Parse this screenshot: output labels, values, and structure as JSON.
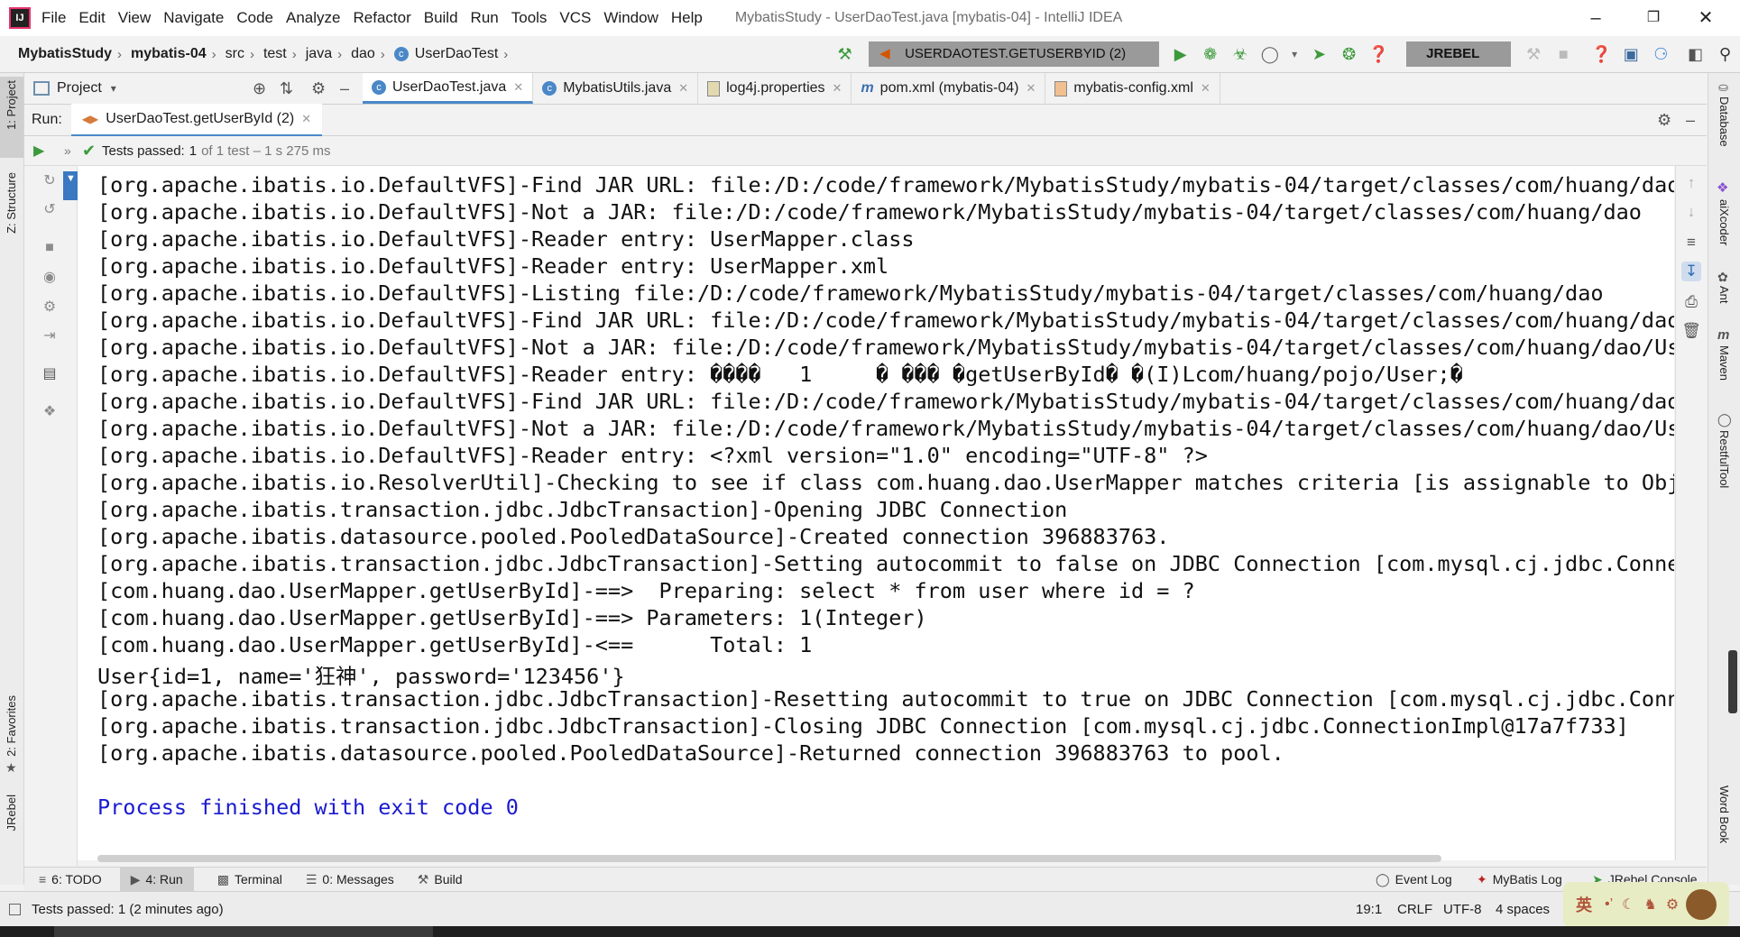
{
  "window": {
    "title": "MybatisStudy - UserDaoTest.java [mybatis-04] - IntelliJ IDEA",
    "menu": [
      "File",
      "Edit",
      "View",
      "Navigate",
      "Code",
      "Analyze",
      "Refactor",
      "Build",
      "Run",
      "Tools",
      "VCS",
      "Window",
      "Help"
    ]
  },
  "breadcrumb": [
    "MybatisStudy",
    "mybatis-04",
    "src",
    "test",
    "java",
    "dao",
    "UserDaoTest"
  ],
  "toolbar": {
    "run_config": "USERDAOTEST.GETUSERBYID (2)",
    "jrebel": "JREBEL"
  },
  "project_panel": {
    "label": "Project"
  },
  "editor_tabs": [
    {
      "label": "UserDaoTest.java",
      "icon": "class-icon"
    },
    {
      "label": "MybatisUtils.java",
      "icon": "class-icon"
    },
    {
      "label": "log4j.properties",
      "icon": "properties-icon"
    },
    {
      "label": "pom.xml (mybatis-04)",
      "icon": "maven-icon"
    },
    {
      "label": "mybatis-config.xml",
      "icon": "xml-icon"
    }
  ],
  "run_panel": {
    "label": "Run:",
    "tab": "UserDaoTest.getUserById (2)",
    "status_passed": "Tests passed:",
    "status_count": "1",
    "status_detail": "of 1 test – 1 s 275 ms"
  },
  "console": {
    "lines": [
      "[org.apache.ibatis.io.DefaultVFS]-Find JAR URL: file:/D:/code/framework/MybatisStudy/mybatis-04/target/classes/com/huang/dao",
      "[org.apache.ibatis.io.DefaultVFS]-Not a JAR: file:/D:/code/framework/MybatisStudy/mybatis-04/target/classes/com/huang/dao",
      "[org.apache.ibatis.io.DefaultVFS]-Reader entry: UserMapper.class",
      "[org.apache.ibatis.io.DefaultVFS]-Reader entry: UserMapper.xml",
      "[org.apache.ibatis.io.DefaultVFS]-Listing file:/D:/code/framework/MybatisStudy/mybatis-04/target/classes/com/huang/dao",
      "[org.apache.ibatis.io.DefaultVFS]-Find JAR URL: file:/D:/code/framework/MybatisStudy/mybatis-04/target/classes/com/huang/dao/",
      "[org.apache.ibatis.io.DefaultVFS]-Not a JAR: file:/D:/code/framework/MybatisStudy/mybatis-04/target/classes/com/huang/dao/Use",
      "[org.apache.ibatis.io.DefaultVFS]-Reader entry: ����   1     � ��� �getUserById� �(I)Lcom/huang/pojo/User;�",
      "[org.apache.ibatis.io.DefaultVFS]-Find JAR URL: file:/D:/code/framework/MybatisStudy/mybatis-04/target/classes/com/huang/dao/",
      "[org.apache.ibatis.io.DefaultVFS]-Not a JAR: file:/D:/code/framework/MybatisStudy/mybatis-04/target/classes/com/huang/dao/Use",
      "[org.apache.ibatis.io.DefaultVFS]-Reader entry: <?xml version=\"1.0\" encoding=\"UTF-8\" ?>",
      "[org.apache.ibatis.io.ResolverUtil]-Checking to see if class com.huang.dao.UserMapper matches criteria [is assignable to Obje",
      "[org.apache.ibatis.transaction.jdbc.JdbcTransaction]-Opening JDBC Connection",
      "[org.apache.ibatis.datasource.pooled.PooledDataSource]-Created connection 396883763.",
      "[org.apache.ibatis.transaction.jdbc.JdbcTransaction]-Setting autocommit to false on JDBC Connection [com.mysql.cj.jdbc.Connec",
      "[com.huang.dao.UserMapper.getUserById]-==>  Preparing: select * from user where id = ?",
      "[com.huang.dao.UserMapper.getUserById]-==> Parameters: 1(Integer)",
      "[com.huang.dao.UserMapper.getUserById]-<==      Total: 1",
      "User{id=1, name='狂神', password='123456'}",
      "[org.apache.ibatis.transaction.jdbc.JdbcTransaction]-Resetting autocommit to true on JDBC Connection [com.mysql.cj.jdbc.Conne",
      "[org.apache.ibatis.transaction.jdbc.JdbcTransaction]-Closing JDBC Connection [com.mysql.cj.jdbc.ConnectionImpl@17a7f733]",
      "[org.apache.ibatis.datasource.pooled.PooledDataSource]-Returned connection 396883763 to pool.",
      "",
      "Process finished with exit code 0"
    ]
  },
  "left_stripe": [
    "1: Project",
    "Z: Structure",
    "2: Favorites",
    "JRebel"
  ],
  "right_stripe": [
    "Database",
    "aiXcoder",
    "Ant",
    "Maven",
    "RestfulTool",
    "Word Book"
  ],
  "bottom_tools": {
    "todo": "6: TODO",
    "run": "4: Run",
    "terminal": "Terminal",
    "messages": "0: Messages",
    "build": "Build",
    "event_log": "Event Log",
    "mybatis_log": "MyBatis Log",
    "jrebel_console": "JRebel Console"
  },
  "status_bar": {
    "message": "Tests passed: 1 (2 minutes ago)",
    "position": "19:1",
    "line_sep": "CRLF",
    "encoding": "UTF-8",
    "indent": "4 spaces"
  },
  "ime": {
    "label": "英"
  },
  "colors": {
    "accent": "#4a88c7",
    "console_blue": "#1a1ad0",
    "pass_green": "#3c9a3c"
  }
}
